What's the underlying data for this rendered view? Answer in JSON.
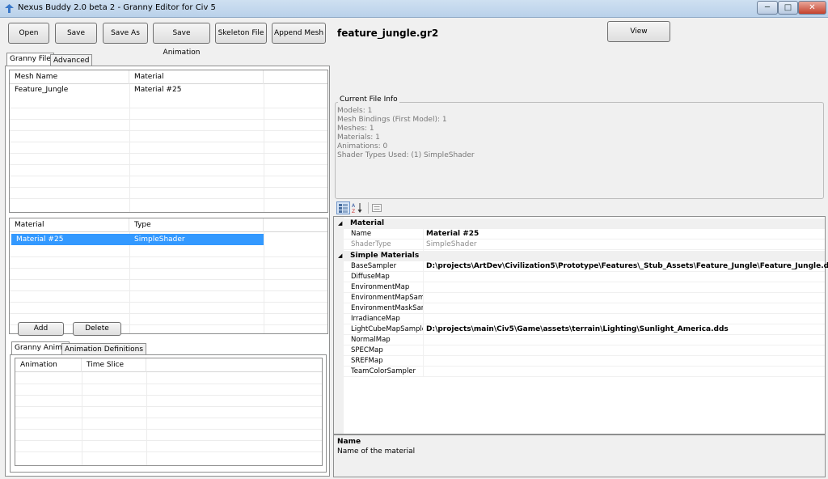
{
  "window": {
    "title": "Nexus Buddy 2.0 beta 2 - Granny Editor for Civ 5",
    "minimize": "─",
    "maximize": "□",
    "close": "✕"
  },
  "toolbar": {
    "open": "Open",
    "save": "Save",
    "save_as": "Save As",
    "save_animation": "Save Animation",
    "skeleton_file": "Skeleton File",
    "append_mesh": "Append Mesh",
    "file_name": "feature_jungle.gr2",
    "view": "View"
  },
  "left_tabs": {
    "granny_file": "Granny File",
    "advanced": "Advanced"
  },
  "mesh_grid": {
    "columns": [
      "Mesh Name",
      "Material"
    ],
    "rows": [
      [
        "Feature_Jungle",
        "Material #25"
      ]
    ]
  },
  "material_grid": {
    "columns": [
      "Material",
      "Type"
    ],
    "rows": [
      [
        "Material #25",
        "SimpleShader"
      ]
    ]
  },
  "material_buttons": {
    "add": "Add",
    "delete": "Delete"
  },
  "anim_tabs": {
    "granny_anims": "Granny Anims",
    "animation_definitions": "Animation Definitions"
  },
  "anim_grid": {
    "columns": [
      "Animation",
      "Time Slice"
    ]
  },
  "file_info": {
    "legend": "Current File Info",
    "lines": [
      "Models: 1",
      "Mesh Bindings (First Model): 1",
      "Meshes: 1",
      "Materials: 1",
      "Animations: 0",
      "Shader Types Used: (1) SimpleShader"
    ]
  },
  "property_grid": {
    "categories": [
      {
        "name": "Material",
        "rows": [
          {
            "name": "Name",
            "value": "Material #25",
            "dim": false
          },
          {
            "name": "ShaderType",
            "value": "SimpleShader",
            "dim": true
          }
        ]
      },
      {
        "name": "Simple Materials",
        "rows": [
          {
            "name": "BaseSampler",
            "value": "D:\\projects\\ArtDev\\Civilization5\\Prototype\\Features\\_Stub_Assets\\Feature_Jungle\\Feature_Jungle.dds",
            "dim": false
          },
          {
            "name": "DiffuseMap",
            "value": "",
            "dim": false
          },
          {
            "name": "EnvironmentMap",
            "value": "",
            "dim": false
          },
          {
            "name": "EnvironmentMapSampl",
            "value": "",
            "dim": false
          },
          {
            "name": "EnvironmentMaskSamp",
            "value": "",
            "dim": false
          },
          {
            "name": "IrradianceMap",
            "value": "",
            "dim": false
          },
          {
            "name": "LightCubeMapSampler",
            "value": "D:\\projects\\main\\Civ5\\Game\\assets\\terrain\\Lighting\\Sunlight_America.dds",
            "dim": false
          },
          {
            "name": "NormalMap",
            "value": "",
            "dim": false
          },
          {
            "name": "SPECMap",
            "value": "",
            "dim": false
          },
          {
            "name": "SREFMap",
            "value": "",
            "dim": false
          },
          {
            "name": "TeamColorSampler",
            "value": "",
            "dim": false
          }
        ]
      }
    ],
    "description": {
      "title": "Name",
      "text": "Name of the material"
    }
  }
}
